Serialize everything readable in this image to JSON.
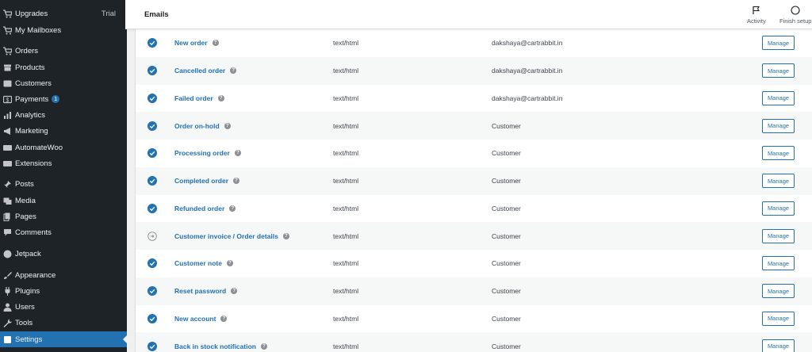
{
  "sidebar": {
    "items": [
      {
        "label": "Upgrades",
        "trail": "Trial",
        "icon": "cart-icon",
        "name": "sidebar-item-upgrades"
      },
      {
        "label": "My Mailboxes",
        "icon": "cart-icon",
        "name": "sidebar-item-my-mailboxes"
      },
      {
        "label": "Orders",
        "icon": "cart-icon",
        "name": "sidebar-item-orders"
      },
      {
        "label": "Products",
        "icon": "archive-icon",
        "name": "sidebar-item-products"
      },
      {
        "label": "Customers",
        "icon": "customers-icon",
        "name": "sidebar-item-customers"
      },
      {
        "label": "Payments",
        "badge": "1",
        "icon": "payments-icon",
        "name": "sidebar-item-payments"
      },
      {
        "label": "Analytics",
        "icon": "analytics-icon",
        "name": "sidebar-item-analytics"
      },
      {
        "label": "Marketing",
        "icon": "megaphone-icon",
        "name": "sidebar-item-marketing"
      },
      {
        "label": "AutomateWoo",
        "icon": "automatewoo-icon",
        "name": "sidebar-item-automatewoo"
      },
      {
        "label": "Extensions",
        "icon": "extensions-icon",
        "name": "sidebar-item-extensions"
      },
      {
        "label": "Posts",
        "icon": "pin-icon",
        "name": "sidebar-item-posts"
      },
      {
        "label": "Media",
        "icon": "media-icon",
        "name": "sidebar-item-media"
      },
      {
        "label": "Pages",
        "icon": "pages-icon",
        "name": "sidebar-item-pages"
      },
      {
        "label": "Comments",
        "icon": "comment-icon",
        "name": "sidebar-item-comments"
      },
      {
        "label": "Jetpack",
        "icon": "jetpack-icon",
        "name": "sidebar-item-jetpack"
      },
      {
        "label": "Appearance",
        "icon": "brush-icon",
        "name": "sidebar-item-appearance"
      },
      {
        "label": "Plugins",
        "icon": "plug-icon",
        "name": "sidebar-item-plugins"
      },
      {
        "label": "Users",
        "icon": "user-icon",
        "name": "sidebar-item-users"
      },
      {
        "label": "Tools",
        "icon": "wrench-icon",
        "name": "sidebar-item-tools"
      },
      {
        "label": "Settings",
        "icon": "settings-icon",
        "name": "sidebar-item-settings",
        "active": true
      }
    ]
  },
  "header": {
    "title": "Emails",
    "activity_label": "Activity",
    "finish_setup_label": "Finish setup"
  },
  "emails": {
    "manage_label": "Manage",
    "help_glyph": "?",
    "rows": [
      {
        "name": "New order",
        "content_type": "text/html",
        "recipient": "dakshaya@cartrabbit.in",
        "enabled": true
      },
      {
        "name": "Cancelled order",
        "content_type": "text/html",
        "recipient": "dakshaya@cartrabbit.in",
        "enabled": true
      },
      {
        "name": "Failed order",
        "content_type": "text/html",
        "recipient": "dakshaya@cartrabbit.in",
        "enabled": true
      },
      {
        "name": "Order on-hold",
        "content_type": "text/html",
        "recipient": "Customer",
        "enabled": true
      },
      {
        "name": "Processing order",
        "content_type": "text/html",
        "recipient": "Customer",
        "enabled": true
      },
      {
        "name": "Completed order",
        "content_type": "text/html",
        "recipient": "Customer",
        "enabled": true
      },
      {
        "name": "Refunded order",
        "content_type": "text/html",
        "recipient": "Customer",
        "enabled": true
      },
      {
        "name": "Customer invoice / Order details",
        "content_type": "text/html",
        "recipient": "Customer",
        "enabled": false
      },
      {
        "name": "Customer note",
        "content_type": "text/html",
        "recipient": "Customer",
        "enabled": true
      },
      {
        "name": "Reset password",
        "content_type": "text/html",
        "recipient": "Customer",
        "enabled": true
      },
      {
        "name": "New account",
        "content_type": "text/html",
        "recipient": "Customer",
        "enabled": true
      },
      {
        "name": "Back in stock notification",
        "content_type": "text/html",
        "recipient": "Customer",
        "enabled": true
      }
    ]
  },
  "colors": {
    "sidebar_bg": "#1d2327",
    "accent": "#2271b1",
    "enabled_check": "#2271b1",
    "disabled_icon": "#8c8f94"
  }
}
